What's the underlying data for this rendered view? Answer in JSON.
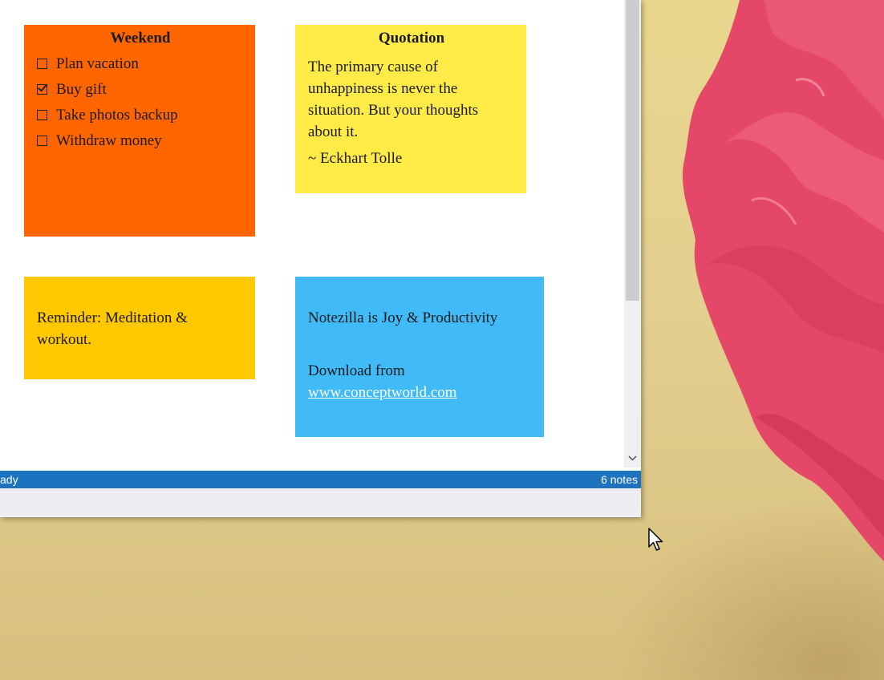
{
  "colors": {
    "weekend_note": "#ff6600",
    "quotation_note": "#ffeb47",
    "reminder_note": "#ffc800",
    "notezilla_note": "#40bbf8",
    "status_bar": "#1e73be"
  },
  "notes": {
    "weekend": {
      "title": "Weekend",
      "items": [
        {
          "text": "Plan vacation",
          "checked": false
        },
        {
          "text": "Buy gift",
          "checked": true
        },
        {
          "text": "Take photos backup",
          "checked": false
        },
        {
          "text": "Withdraw money",
          "checked": false
        }
      ]
    },
    "quotation": {
      "title": "Quotation",
      "body": "The primary cause of unhappiness is never the situation. But your thoughts about it.",
      "author": "~ Eckhart Tolle"
    },
    "reminder": {
      "body": "Reminder: Meditation & workout."
    },
    "notezilla": {
      "line1": "Notezilla is Joy & Productivity",
      "line2": "Download from",
      "link": "www.conceptworld.com"
    }
  },
  "statusbar": {
    "left": "ady",
    "right": "6 notes"
  }
}
